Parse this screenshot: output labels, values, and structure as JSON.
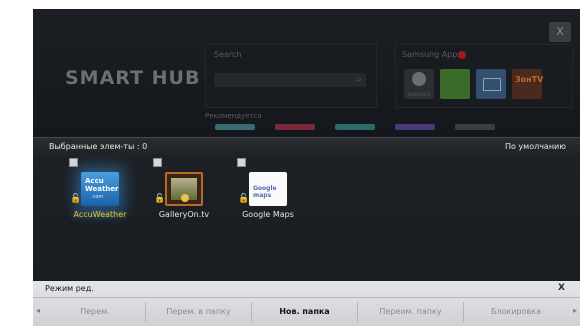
{
  "hub": {
    "logo": "SMART HUB",
    "close_label": "X",
    "search": {
      "label": "Search"
    },
    "samsung_apps": {
      "label": "Samsung Apps",
      "apps": [
        {
          "name": "samsung-app-ball",
          "caption": "SUNDANCE"
        },
        {
          "name": "samsung-app-green"
        },
        {
          "name": "samsung-app-mail"
        },
        {
          "name": "samsung-app-tv",
          "caption": "ЗонТV"
        }
      ]
    },
    "recommend_label": "Рекомендуется"
  },
  "favorites": {
    "count_label": "Выбранные элем-ты : 0",
    "sort_label": "По умолчанию",
    "items": [
      {
        "label": "AccuWeather",
        "selected": true,
        "icon_text": [
          "Accu",
          "Weather",
          ".com"
        ]
      },
      {
        "label": "GalleryOn.tv",
        "selected": false
      },
      {
        "label": "Google Maps",
        "selected": false,
        "icon_text": "Google maps"
      }
    ]
  },
  "edit_mode": {
    "title": "Режим ред.",
    "close_label": "X",
    "menu": [
      {
        "label": "Перем.",
        "active": false
      },
      {
        "label": "Перем. в папку",
        "active": false
      },
      {
        "label": "Нов. папка",
        "active": true
      },
      {
        "label": "Переим. папку",
        "active": false
      },
      {
        "label": "Блокировка",
        "active": false
      }
    ]
  },
  "colors": {
    "accent_selected": "#f1c40f",
    "selection_glow": "#3c96e6",
    "samsung_apps_badge": "#a01a1a"
  }
}
